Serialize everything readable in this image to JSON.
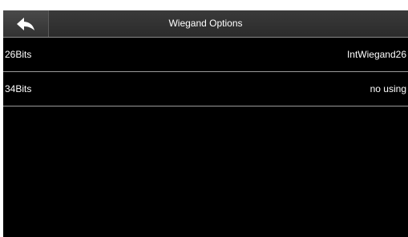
{
  "header": {
    "title": "Wiegand Options",
    "back_icon": "back-arrow-icon"
  },
  "options": [
    {
      "label": "26Bits",
      "value": "IntWiegand26"
    },
    {
      "label": "34Bits",
      "value": "no using"
    }
  ],
  "colors": {
    "background": "#000000",
    "title_bar": "#2f2f2f",
    "text": "#ffffff",
    "divider": "#9a9a9a"
  }
}
